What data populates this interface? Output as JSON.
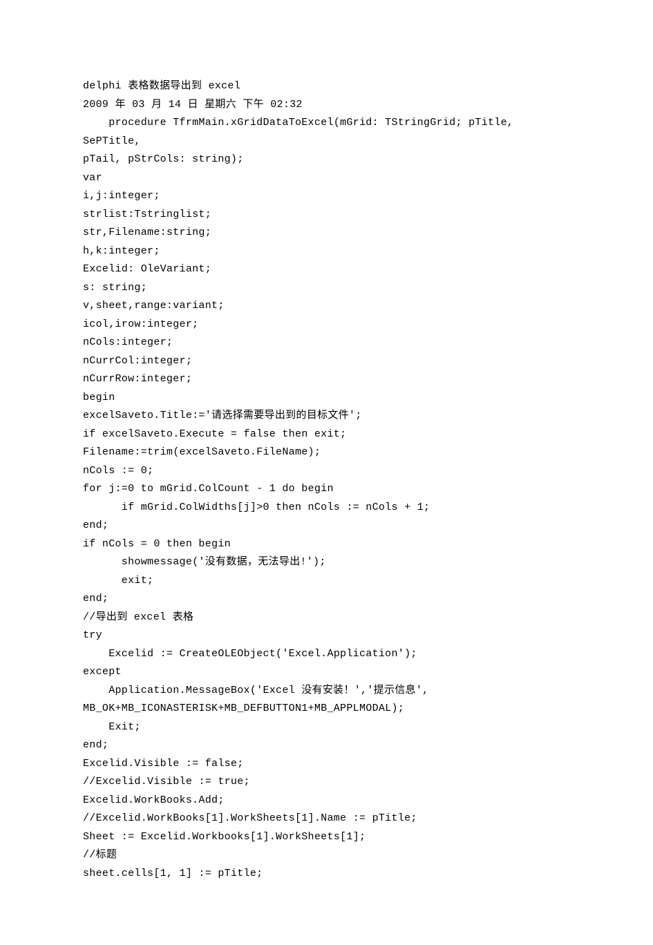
{
  "title_line": "delphi 表格数据导出到 excel",
  "date_line": "2009 年 03 月 14 日 星期六 下午 02:32",
  "code_lines": [
    "    procedure TfrmMain.xGridDataToExcel(mGrid: TStringGrid; pTitle,",
    "SePTitle,",
    "pTail, pStrCols: string);",
    "var",
    "i,j:integer;",
    "strlist:Tstringlist;",
    "str,Filename:string;",
    "h,k:integer;",
    "Excelid: OleVariant;",
    "s: string;",
    "v,sheet,range:variant;",
    "icol,irow:integer;",
    "nCols:integer;",
    "nCurrCol:integer;",
    "nCurrRow:integer;",
    "begin",
    "excelSaveto.Title:='请选择需要导出到的目标文件';",
    "if excelSaveto.Execute = false then exit;",
    "Filename:=trim(excelSaveto.FileName);",
    "nCols := 0;",
    "for j:=0 to mGrid.ColCount - 1 do begin",
    "      if mGrid.ColWidths[j]>0 then nCols := nCols + 1;",
    "end;",
    "if nCols = 0 then begin",
    "      showmessage('没有数据，无法导出!');",
    "      exit;",
    "end;",
    "//导出到 excel 表格",
    "try",
    "    Excelid := CreateOLEObject('Excel.Application');",
    "except",
    "    Application.MessageBox('Excel 没有安装！','提示信息',",
    "MB_OK+MB_ICONASTERISK+MB_DEFBUTTON1+MB_APPLMODAL);",
    "    Exit;",
    "end;",
    "Excelid.Visible := false;",
    "//Excelid.Visible := true;",
    "Excelid.WorkBooks.Add;",
    "//Excelid.WorkBooks[1].WorkSheets[1].Name := pTitle;",
    "Sheet := Excelid.Workbooks[1].WorkSheets[1];",
    "//标题",
    "sheet.cells[1, 1] := pTitle;"
  ]
}
